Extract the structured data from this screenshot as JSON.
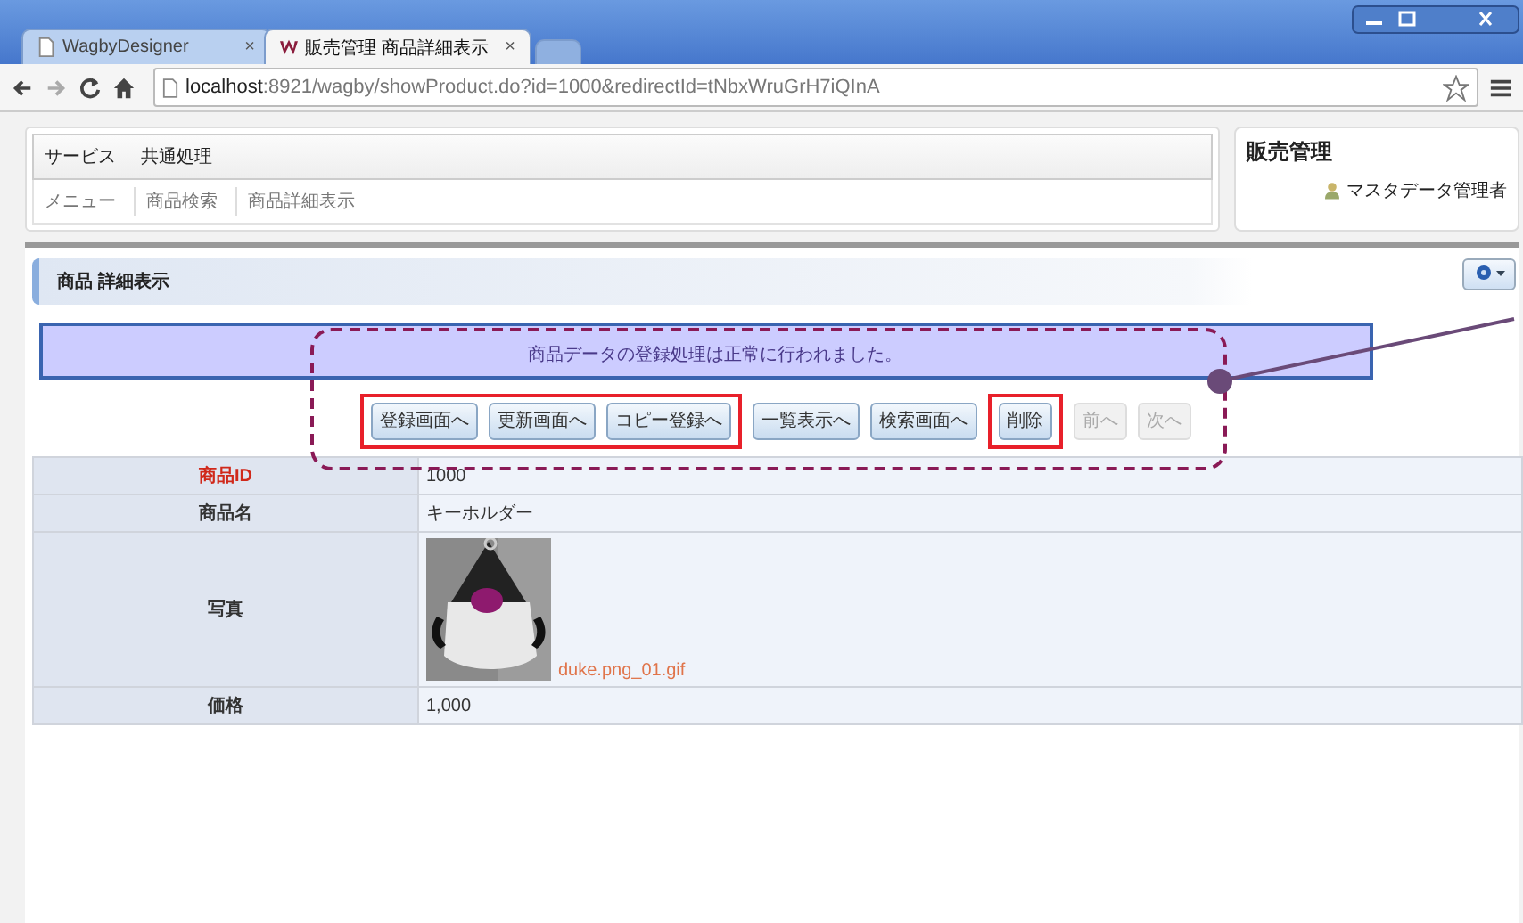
{
  "browser": {
    "tabs": [
      {
        "title": "WagbyDesigner",
        "close": "×",
        "selected": false,
        "kind": "page"
      },
      {
        "title": "販売管理 商品詳細表示",
        "close": "×",
        "selected": true,
        "kind": "app"
      }
    ],
    "url_host": "localhost",
    "url_rest": ":8921/wagby/showProduct.do?id=1000&redirectId=tNbxWruGrH7iQInA"
  },
  "menu": [
    "サービス",
    "共通処理"
  ],
  "breadcrumb": [
    "メニュー",
    "商品検索",
    "商品詳細表示"
  ],
  "app": {
    "title": "販売管理",
    "user": "マスタデータ管理者"
  },
  "section_title": "商品 詳細表示",
  "message": "商品データの登録処理は正常に行われました。",
  "buttons": [
    {
      "label": "登録画面へ",
      "disabled": false,
      "highlighted": true
    },
    {
      "label": "更新画面へ",
      "disabled": false,
      "highlighted": true
    },
    {
      "label": "コピー登録へ",
      "disabled": false,
      "highlighted": true
    },
    {
      "label": "一覧表示へ",
      "disabled": false,
      "highlighted": false
    },
    {
      "label": "検索画面へ",
      "disabled": false,
      "highlighted": false
    },
    {
      "label": "削除",
      "disabled": false,
      "highlighted": true
    },
    {
      "label": "前へ",
      "disabled": true,
      "highlighted": false
    },
    {
      "label": "次へ",
      "disabled": true,
      "highlighted": false
    }
  ],
  "fields": [
    {
      "label": "商品ID",
      "required": true,
      "kind": "text",
      "value": "1000"
    },
    {
      "label": "商品名",
      "required": false,
      "kind": "text",
      "value": "キーホルダー"
    },
    {
      "label": "写真",
      "required": false,
      "value": "duke.png_01.gif"
    },
    {
      "label": "価格",
      "required": false,
      "kind": "text",
      "value": "1,000"
    }
  ]
}
